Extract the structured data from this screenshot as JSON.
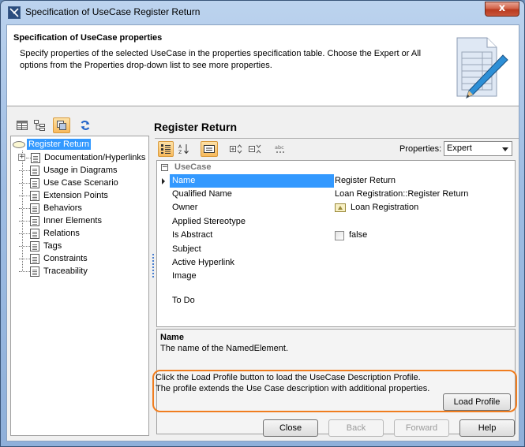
{
  "window": {
    "title": "Specification of UseCase Register Return",
    "close_label": "x"
  },
  "header": {
    "title": "Specification of UseCase properties",
    "description": "Specify properties of the selected UseCase in the properties specification table. Choose the Expert or All options from the Properties drop-down list to see more properties."
  },
  "tree": {
    "root": "Register Return",
    "items": [
      {
        "label": "Documentation/Hyperlinks",
        "expandable": true
      },
      {
        "label": "Usage in Diagrams"
      },
      {
        "label": "Use Case Scenario"
      },
      {
        "label": "Extension Points"
      },
      {
        "label": "Behaviors"
      },
      {
        "label": "Inner Elements"
      },
      {
        "label": "Relations"
      },
      {
        "label": "Tags"
      },
      {
        "label": "Constraints"
      },
      {
        "label": "Traceability"
      }
    ]
  },
  "main": {
    "element_title": "Register Return",
    "properties_label": "Properties:",
    "properties_value": "Expert",
    "group_label": "UseCase",
    "rows": [
      {
        "name": "Name",
        "value": "Register Return"
      },
      {
        "name": "Qualified Name",
        "value": "Loan Registration::Register Return"
      },
      {
        "name": "Owner",
        "value": "Loan Registration"
      },
      {
        "name": "Applied Stereotype",
        "value": ""
      },
      {
        "name": "Is Abstract",
        "value": "false"
      },
      {
        "name": "Subject",
        "value": ""
      },
      {
        "name": "Active Hyperlink",
        "value": ""
      },
      {
        "name": "Image",
        "value": ""
      },
      {
        "name": "To Do",
        "value": ""
      }
    ],
    "description": {
      "name": "Name",
      "text": "The name of the NamedElement."
    },
    "profile": {
      "line1": "Click the Load Profile button to load the UseCase Description Profile.",
      "line2": "The profile extends the Use Case description with additional properties.",
      "button": "Load Profile"
    }
  },
  "buttons": {
    "close": "Close",
    "back": "Back",
    "forward": "Forward",
    "help": "Help"
  },
  "colors": {
    "selection": "#3399ff",
    "highlight": "#f07d1f"
  }
}
